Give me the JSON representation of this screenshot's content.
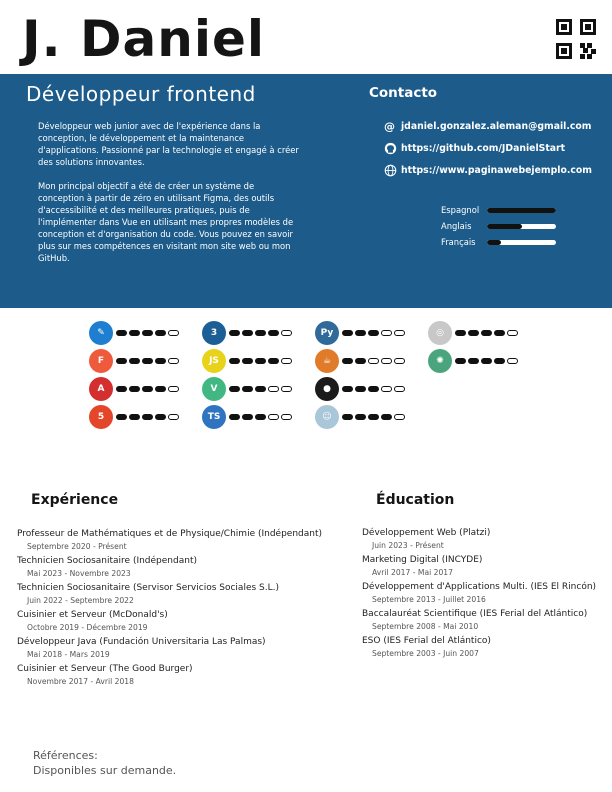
{
  "header": {
    "name": "J. Daniel",
    "qr_icon": "qr-code-icon"
  },
  "profile": {
    "role": "Développeur frontend",
    "bio_1": "Développeur web junior avec de l'expérience dans la conception, le développement et la maintenance d'applications. Passionné par la technologie et engagé à créer des solutions innovantes.",
    "bio_2": "Mon principal objectif a été de créer un système de conception à partir de zéro en utilisant Figma, des outils d'accessibilité et des meilleures pratiques, puis de l'implémenter dans Vue en utilisant mes propres modèles de conception et d'organisation du code. Vous pouvez en savoir plus sur mes compétences en visitant mon site web ou mon GitHub."
  },
  "contact": {
    "title": "Contacto",
    "email": "jdaniel.gonzalez.aleman@gmail.com",
    "github": "https://github.com/JDanielStart",
    "website": "https://www.paginawebejemplo.com"
  },
  "languages": [
    {
      "label": "Espagnol",
      "level": 1.0
    },
    {
      "label": "Anglais",
      "level": 0.5
    },
    {
      "label": "Français",
      "level": 0.2
    }
  ],
  "skills": [
    {
      "icon": "pencil-tool-icon",
      "color": "#1e7fd0",
      "glyph": "✎",
      "level": 4
    },
    {
      "icon": "css3-icon",
      "color": "#1c5f96",
      "glyph": "3",
      "level": 4
    },
    {
      "icon": "python-icon",
      "color": "#2f6a9a",
      "glyph": "Py",
      "level": 3
    },
    {
      "icon": "openai-icon",
      "color": "#c8c8c8",
      "glyph": "◎",
      "level": 4
    },
    {
      "icon": "figma-icon",
      "color": "#f05a3c",
      "glyph": "F",
      "level": 4
    },
    {
      "icon": "javascript-icon",
      "color": "#e8d21a",
      "glyph": "JS",
      "level": 4
    },
    {
      "icon": "java-icon",
      "color": "#e07b2a",
      "glyph": "☕",
      "level": 2
    },
    {
      "icon": "chatgpt-icon",
      "color": "#4aa57e",
      "glyph": "✺",
      "level": 4
    },
    {
      "icon": "angular-icon",
      "color": "#d32f2f",
      "glyph": "A",
      "level": 4
    },
    {
      "icon": "vue-icon",
      "color": "#41b883",
      "glyph": "V",
      "level": 3
    },
    {
      "icon": "github-icon",
      "color": "#1b1b1b",
      "glyph": "●",
      "level": 3
    },
    {
      "icon": "html5-icon",
      "color": "#e4462a",
      "glyph": "5",
      "level": 4
    },
    {
      "icon": "typescript-icon",
      "color": "#2f74c0",
      "glyph": "TS",
      "level": 3
    },
    {
      "icon": "robot-icon",
      "color": "#a9c7d8",
      "glyph": "☺",
      "level": 4
    }
  ],
  "experience": {
    "title": "Expérience",
    "items": [
      {
        "role": "Professeur de Mathématiques et de Physique/Chimie (Indépendant)",
        "date": "Septembre 2020 - Présent"
      },
      {
        "role": "Technicien Sociosanitaire (Indépendant)",
        "date": "Mai 2023 - Novembre 2023"
      },
      {
        "role": "Technicien Sociosanitaire (Servisor Servicios Sociales S.L.)",
        "date": "Juin 2022 - Septembre 2022"
      },
      {
        "role": "Cuisinier et Serveur (McDonald's)",
        "date": "Octobre 2019 - Décembre 2019"
      },
      {
        "role": "Développeur Java (Fundación Universitaria Las Palmas)",
        "date": "Mai 2018 - Mars 2019"
      },
      {
        "role": "Cuisinier et Serveur (The Good Burger)",
        "date": "Novembre 2017 - Avril 2018"
      }
    ]
  },
  "education": {
    "title": "Éducation",
    "items": [
      {
        "role": "Développement Web (Platzi)",
        "date": "Juin 2023 - Présent"
      },
      {
        "role": "Marketing Digital (INCYDE)",
        "date": "Avril 2017 - Mai 2017"
      },
      {
        "role": "Développement d'Applications Multi. (IES El Rincón)",
        "date": "Septembre 2013 - Juillet 2016"
      },
      {
        "role": "Baccalauréat Scientifique (IES Ferial del Atlántico)",
        "date": "Septembre 2008 - Mai 2010"
      },
      {
        "role": "ESO (IES Ferial del Atlántico)",
        "date": "Septembre 2003 - Juin 2007"
      }
    ]
  },
  "references": {
    "label": "Références:",
    "text": "Disponibles sur demande."
  }
}
